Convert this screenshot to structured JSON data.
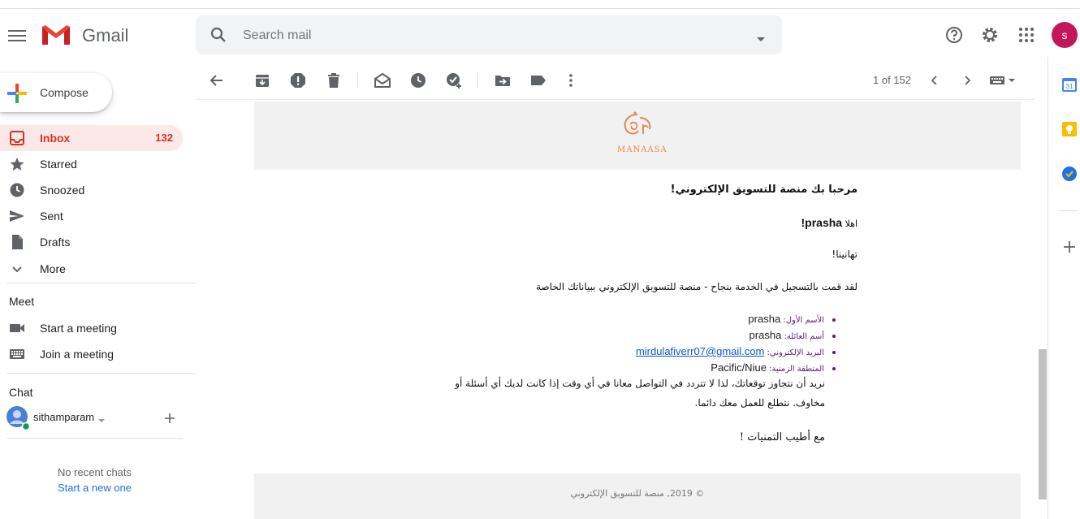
{
  "app": {
    "name": "Gmail"
  },
  "search": {
    "placeholder": "Search mail"
  },
  "user": {
    "initial": "s"
  },
  "compose": {
    "label": "Compose"
  },
  "nav": [
    {
      "label": "Inbox",
      "count": "132",
      "icon": "inbox-icon"
    },
    {
      "label": "Starred",
      "count": "",
      "icon": "star-icon"
    },
    {
      "label": "Snoozed",
      "count": "",
      "icon": "clock-icon"
    },
    {
      "label": "Sent",
      "count": "",
      "icon": "send-icon"
    },
    {
      "label": "Drafts",
      "count": "",
      "icon": "draft-icon"
    },
    {
      "label": "More",
      "count": "",
      "icon": "chevron-down-icon"
    }
  ],
  "meet": {
    "heading": "Meet",
    "start": "Start a meeting",
    "join": "Join a meeting"
  },
  "chat": {
    "heading": "Chat",
    "user": "sithamparam",
    "no_recent": "No recent chats",
    "start_new": "Start a new one"
  },
  "toolbar": {
    "paging": "1 of 152"
  },
  "email": {
    "logo_text": "MANAASA",
    "welcome": "مرحبا بك منصة للتسويق الإلكتروني!",
    "greeting_prefix": "اهلا ",
    "greeting_name": "prasha!",
    "congrats": "تهانينا!",
    "registered": "لقد قمت بالتسجيل في الخدمة بنجاح - منصة للتسويق الإلكتروني ببياناتك الخاصة",
    "fields": [
      {
        "label": "الأسم الأول: ",
        "value": "prasha",
        "link": false
      },
      {
        "label": "أسم العائلة: ",
        "value": "prasha",
        "link": false
      },
      {
        "label": "البريد الإلكتروني: ",
        "value": "mirdulafiverr07@gmail.com",
        "link": true
      },
      {
        "label": "المنطقة الزمنية: ",
        "value": "Pacific/Niue",
        "link": false
      }
    ],
    "paragraph_line1": "نريد أن نتجاوز توقعاتك، لذا لا تتردد في التواصل معانا في أي وقت إذا كانت لديك أي أسئلة أو",
    "paragraph_line2": "مخاوف. نتطلع للعمل معك دائما.",
    "signoff": "مع أطيب التمنيات !",
    "footer": "© 2019, منصة للتسويق الإلكتروني"
  },
  "colors": {
    "accent_red": "#d93025",
    "inbox_bg": "#fce8e6",
    "link_blue": "#1a73e8"
  }
}
